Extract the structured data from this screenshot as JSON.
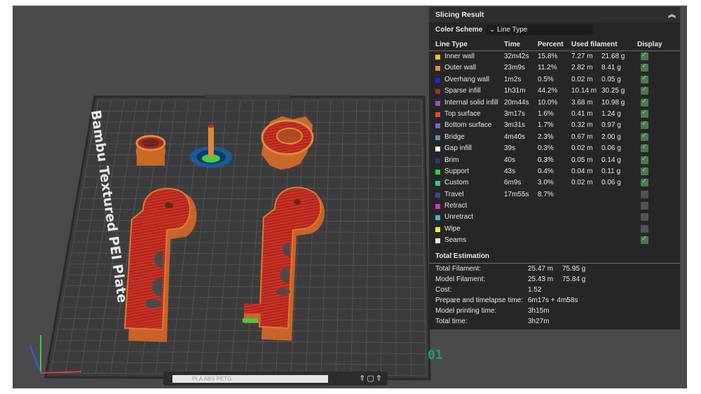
{
  "viewport": {
    "plate_name": "Bambu Textured PEI Plate",
    "plate_number": "01",
    "bottom_bar_label": "PLA ABS PETG",
    "bottom_bar_icons": "⇑▢⇑"
  },
  "panel": {
    "title": "Slicing Result",
    "collapse_icon": "︽",
    "color_scheme_label": "Color Scheme",
    "color_scheme_value": "Line Type",
    "chevron": "⌄",
    "columns": [
      "Line Type",
      "Time",
      "Percent",
      "Used filament",
      "Display"
    ],
    "rows": [
      {
        "name": "Inner wall",
        "color": "#f5c518",
        "time": "32m42s",
        "percent": "15.8%",
        "length": "7.27 m",
        "weight": "21.68 g",
        "display": true
      },
      {
        "name": "Outer wall",
        "color": "#f08a24",
        "time": "23m9s",
        "percent": "11.2%",
        "length": "2.82 m",
        "weight": "8.41 g",
        "display": true
      },
      {
        "name": "Overhang wall",
        "color": "#2323e8",
        "time": "1m2s",
        "percent": "0.5%",
        "length": "0.02 m",
        "weight": "0.05 g",
        "display": true
      },
      {
        "name": "Sparse infill",
        "color": "#a83030",
        "time": "1h31m",
        "percent": "44.2%",
        "length": "10.14 m",
        "weight": "30.25 g",
        "display": true
      },
      {
        "name": "Internal solid infill",
        "color": "#9c4fc8",
        "time": "20m44s",
        "percent": "10.0%",
        "length": "3.68 m",
        "weight": "10.98 g",
        "display": true
      },
      {
        "name": "Top surface",
        "color": "#e8473e",
        "time": "3m17s",
        "percent": "1.6%",
        "length": "0.41 m",
        "weight": "1.24 g",
        "display": true
      },
      {
        "name": "Bottom surface",
        "color": "#7b68c8",
        "time": "3m31s",
        "percent": "1.7%",
        "length": "0.32 m",
        "weight": "0.97 g",
        "display": true
      },
      {
        "name": "Bridge",
        "color": "#5f8fc0",
        "time": "4m40s",
        "percent": "2.3%",
        "length": "0.67 m",
        "weight": "2.00 g",
        "display": true
      },
      {
        "name": "Gap infill",
        "color": "#ffffff",
        "time": "39s",
        "percent": "0.3%",
        "length": "0.02 m",
        "weight": "0.06 g",
        "display": true
      },
      {
        "name": "Brim",
        "color": "#1a3f6e",
        "time": "40s",
        "percent": "0.3%",
        "length": "0.05 m",
        "weight": "0.14 g",
        "display": true
      },
      {
        "name": "Support",
        "color": "#2ed12e",
        "time": "43s",
        "percent": "0.4%",
        "length": "0.04 m",
        "weight": "0.11 g",
        "display": true
      },
      {
        "name": "Custom",
        "color": "#3ec89a",
        "time": "6m9s",
        "percent": "3.0%",
        "length": "0.02 m",
        "weight": "0.06 g",
        "display": true
      },
      {
        "name": "Travel",
        "color": "#3a4a9a",
        "time": "17m55s",
        "percent": "8.7%",
        "length": "",
        "weight": "",
        "display": false
      },
      {
        "name": "Retract",
        "color": "#c83ac8",
        "time": "",
        "percent": "",
        "length": "",
        "weight": "",
        "display": false
      },
      {
        "name": "Unretract",
        "color": "#4ab0d8",
        "time": "",
        "percent": "",
        "length": "",
        "weight": "",
        "display": false
      },
      {
        "name": "Wipe",
        "color": "#f5f520",
        "time": "",
        "percent": "",
        "length": "",
        "weight": "",
        "display": false
      },
      {
        "name": "Seams",
        "color": "#f0f0f0",
        "time": "",
        "percent": "",
        "length": "",
        "weight": "",
        "display": true
      }
    ],
    "total_title": "Total Estimation",
    "estimates": [
      {
        "label": "Total Filament:",
        "v1": "25.47 m",
        "v2": "75.95 g"
      },
      {
        "label": "Model Filament:",
        "v1": "25.43 m",
        "v2": "75.84 g"
      },
      {
        "label": "Cost:",
        "v1": "1.52",
        "v2": ""
      },
      {
        "label": "Prepare and timelapse time:",
        "v1": "6m17s + 4m58s",
        "v2": ""
      },
      {
        "label": "Model printing time:",
        "v1": "3h15m",
        "v2": ""
      },
      {
        "label": "Total time:",
        "v1": "3h27m",
        "v2": ""
      }
    ]
  }
}
